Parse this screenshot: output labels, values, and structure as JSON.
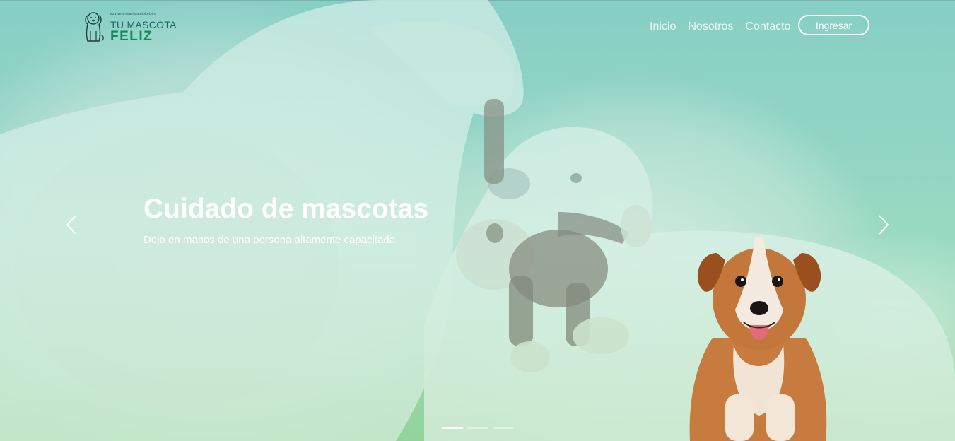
{
  "brand": {
    "tagline": "eza veterinaria antioketrés",
    "line1": "TU MASCOTA",
    "line2": "FELIZ"
  },
  "nav": {
    "links": [
      "Inicio",
      "Nosotros",
      "Contacto"
    ],
    "button_label": "Ingresar"
  },
  "carousel": {
    "title": "Cuidado de mascotas",
    "text": "Deja en manos de una persona altamente capacitada.",
    "slide_count": 3,
    "active_slide": 1
  },
  "icons": {
    "prev": "chevron-left-icon",
    "next": "chevron-right-icon",
    "logo": "dog-logo-icon"
  },
  "colors": {
    "overlay": "#8fcfc6",
    "brand_green": "#0f8a5a",
    "text": "#ffffff"
  }
}
